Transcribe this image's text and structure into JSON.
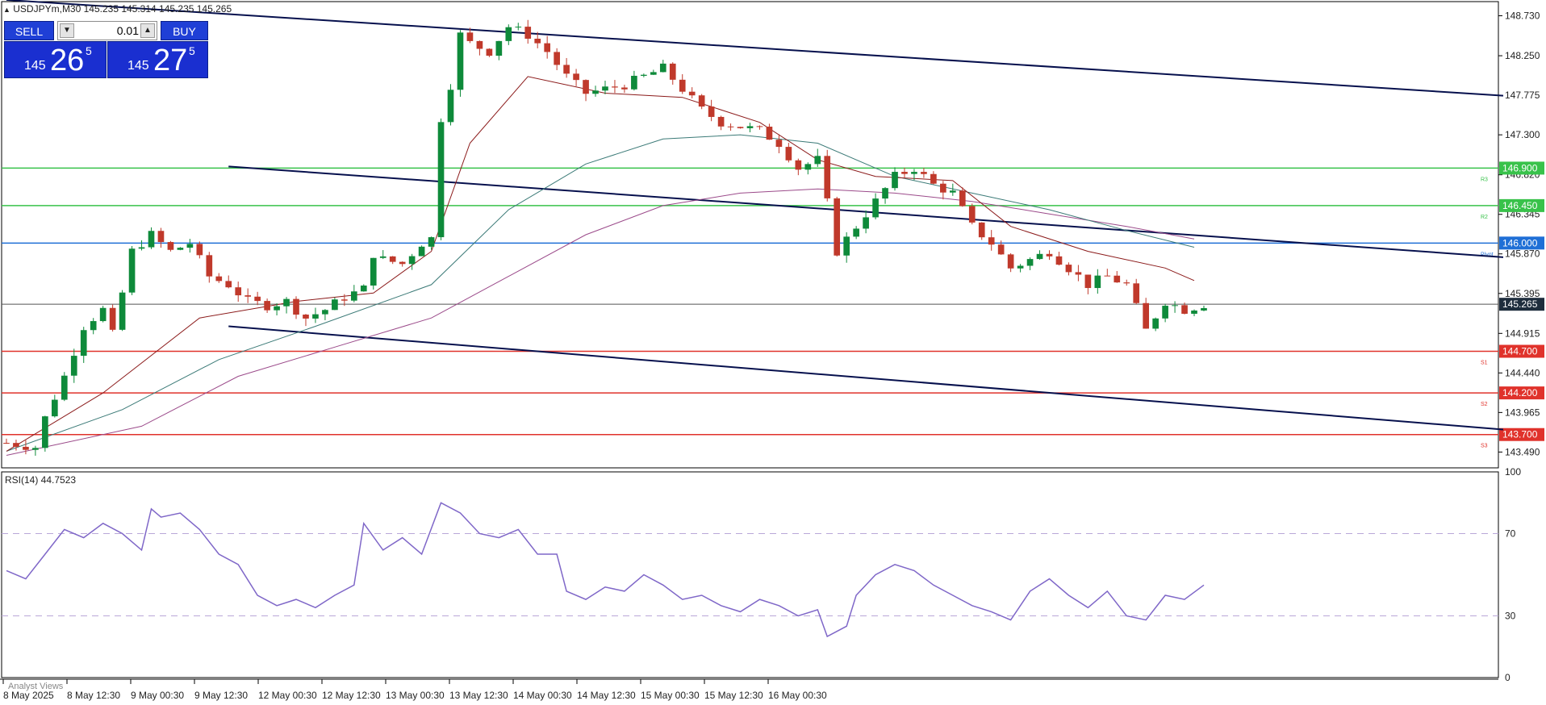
{
  "header": {
    "symbol_text": "USDJPYm,M30  145.235 145.314 145.235 145.265",
    "menu_icon": "triangle-up-icon"
  },
  "trade_panel": {
    "sell_label": "SELL",
    "buy_label": "BUY",
    "lot_value": "0.01",
    "sell_price": {
      "small": "145",
      "big": "26",
      "sup": "5"
    },
    "buy_price": {
      "small": "145",
      "big": "27",
      "sup": "5"
    },
    "colors": {
      "button": "#1f3fd6",
      "price": "#1a2fd0"
    }
  },
  "rsi_title": "RSI(14) 44.7523",
  "bottom_label": "Analyst Views",
  "colors": {
    "bull": "#0e8a3a",
    "bear": "#c0392b",
    "channel": "#06104d",
    "resistance": "#38c24a",
    "pivot": "#1f6fd6",
    "support": "#e0322b",
    "ma_fast": "#8b1a1a",
    "ma_mid": "#3b7a77",
    "ma_slow": "#9b4a8a",
    "rsi": "#7f67c8"
  },
  "chart_data": [
    {
      "type": "candlestick",
      "symbol": "USDJPYm",
      "timeframe": "M30",
      "ohlc_last": {
        "open": 145.235,
        "high": 145.314,
        "low": 145.235,
        "close": 145.265
      },
      "ylim": [
        143.3,
        148.9
      ],
      "y_ticks": [
        148.73,
        148.25,
        147.775,
        147.3,
        146.82,
        146.345,
        145.87,
        145.395,
        144.915,
        144.44,
        143.965,
        143.49
      ],
      "y_tick_labels": [
        "148.730",
        "148.250",
        "147.775",
        "147.300",
        "146.820",
        "146.345",
        "145.870",
        "145.395",
        "144.915",
        "144.440",
        "143.965",
        "143.490"
      ],
      "x_tick_labels": [
        "8 May 2025",
        "8 May 12:30",
        "9 May 00:30",
        "9 May 12:30",
        "12 May 00:30",
        "12 May 12:30",
        "13 May 00:30",
        "13 May 12:30",
        "14 May 00:30",
        "14 May 12:30",
        "15 May 00:30",
        "15 May 12:30",
        "16 May 00:30"
      ],
      "price_path": [
        [
          0,
          143.6
        ],
        [
          3,
          143.55
        ],
        [
          4,
          143.9
        ],
        [
          6,
          144.4
        ],
        [
          8,
          145.0
        ],
        [
          10,
          145.2
        ],
        [
          11,
          144.9
        ],
        [
          13,
          145.9
        ],
        [
          15,
          146.1
        ],
        [
          17,
          145.9
        ],
        [
          19,
          146.0
        ],
        [
          21,
          145.6
        ],
        [
          23,
          145.5
        ],
        [
          25,
          145.3
        ],
        [
          27,
          145.25
        ],
        [
          29,
          145.3
        ],
        [
          31,
          145.1
        ],
        [
          33,
          145.2
        ],
        [
          35,
          145.35
        ],
        [
          37,
          145.45
        ],
        [
          37.6,
          145.9
        ],
        [
          39,
          145.8
        ],
        [
          41,
          145.75
        ],
        [
          43,
          146.0
        ],
        [
          44.8,
          146.1
        ],
        [
          45,
          147.5
        ],
        [
          46,
          147.9
        ],
        [
          47,
          148.5
        ],
        [
          48,
          148.4
        ],
        [
          50,
          148.3
        ],
        [
          52,
          148.6
        ],
        [
          54,
          148.5
        ],
        [
          56,
          148.3
        ],
        [
          58,
          148.0
        ],
        [
          60,
          147.8
        ],
        [
          62,
          147.85
        ],
        [
          64,
          147.9
        ],
        [
          66,
          148.0
        ],
        [
          68,
          148.1
        ],
        [
          70,
          147.85
        ],
        [
          72,
          147.6
        ],
        [
          74,
          147.45
        ],
        [
          76,
          147.4
        ],
        [
          78,
          147.35
        ],
        [
          80,
          147.2
        ],
        [
          82,
          146.9
        ],
        [
          84,
          147.0
        ],
        [
          84.8,
          146.6
        ],
        [
          86,
          145.9
        ],
        [
          88,
          146.2
        ],
        [
          90,
          146.5
        ],
        [
          92,
          146.8
        ],
        [
          94,
          146.9
        ],
        [
          96,
          146.7
        ],
        [
          98,
          146.6
        ],
        [
          100,
          146.2
        ],
        [
          102,
          146.0
        ],
        [
          104,
          145.7
        ],
        [
          106,
          145.8
        ],
        [
          108,
          145.9
        ],
        [
          110,
          145.7
        ],
        [
          112,
          145.5
        ],
        [
          114,
          145.6
        ],
        [
          116,
          145.5
        ],
        [
          118,
          144.95
        ],
        [
          120,
          145.3
        ],
        [
          122,
          145.2
        ],
        [
          124,
          145.265
        ]
      ],
      "indicators": {
        "ma_fast_path": [
          [
            0,
            143.5
          ],
          [
            10,
            144.2
          ],
          [
            20,
            145.1
          ],
          [
            30,
            145.3
          ],
          [
            38,
            145.4
          ],
          [
            44,
            145.9
          ],
          [
            48,
            147.2
          ],
          [
            54,
            148.0
          ],
          [
            62,
            147.8
          ],
          [
            70,
            147.75
          ],
          [
            78,
            147.45
          ],
          [
            84,
            147.0
          ],
          [
            90,
            146.8
          ],
          [
            98,
            146.75
          ],
          [
            104,
            146.2
          ],
          [
            112,
            145.9
          ],
          [
            120,
            145.7
          ],
          [
            123,
            145.55
          ]
        ],
        "ma_mid_path": [
          [
            0,
            143.5
          ],
          [
            12,
            144.0
          ],
          [
            22,
            144.6
          ],
          [
            32,
            145.0
          ],
          [
            44,
            145.5
          ],
          [
            52,
            146.4
          ],
          [
            60,
            146.95
          ],
          [
            68,
            147.25
          ],
          [
            76,
            147.3
          ],
          [
            84,
            147.2
          ],
          [
            92,
            146.8
          ],
          [
            100,
            146.6
          ],
          [
            108,
            146.4
          ],
          [
            116,
            146.15
          ],
          [
            123,
            145.95
          ]
        ],
        "ma_slow_path": [
          [
            0,
            143.45
          ],
          [
            14,
            143.8
          ],
          [
            24,
            144.4
          ],
          [
            34,
            144.75
          ],
          [
            44,
            145.1
          ],
          [
            52,
            145.6
          ],
          [
            60,
            146.1
          ],
          [
            68,
            146.45
          ],
          [
            76,
            146.6
          ],
          [
            84,
            146.65
          ],
          [
            92,
            146.6
          ],
          [
            100,
            146.5
          ],
          [
            108,
            146.35
          ],
          [
            116,
            146.2
          ],
          [
            123,
            146.05
          ]
        ]
      },
      "horizontal_levels": [
        {
          "name": "R3",
          "value": 146.9,
          "label": "146.900",
          "color": "#38c24a"
        },
        {
          "name": "R2",
          "value": 146.45,
          "label": "146.450",
          "color": "#38c24a"
        },
        {
          "name": "Pivot",
          "value": 146.0,
          "label": "146.000",
          "color": "#1f6fd6"
        },
        {
          "name": "S1",
          "value": 144.7,
          "label": "144.700",
          "color": "#e0322b"
        },
        {
          "name": "S2",
          "value": 144.2,
          "label": "144.200",
          "color": "#e0322b"
        },
        {
          "name": "S3",
          "value": 143.7,
          "label": "143.700",
          "color": "#e0322b"
        }
      ],
      "current_price": {
        "value": 145.265,
        "label": "145.265"
      },
      "channel_lines": [
        {
          "from": [
            0,
            148.92
          ],
          "to": [
            155,
            147.77
          ]
        },
        {
          "from": [
            23,
            146.92
          ],
          "to": [
            155,
            145.83
          ]
        },
        {
          "from": [
            23,
            145.0
          ],
          "to": [
            155,
            143.76
          ]
        }
      ]
    },
    {
      "type": "line",
      "title": "RSI(14) 44.7523",
      "ylim": [
        0,
        100
      ],
      "y_ticks": [
        0,
        30,
        70,
        100
      ],
      "levels": [
        30,
        70
      ],
      "values": [
        [
          0,
          52
        ],
        [
          2,
          48
        ],
        [
          4,
          60
        ],
        [
          6,
          72
        ],
        [
          8,
          68
        ],
        [
          10,
          75
        ],
        [
          12,
          70
        ],
        [
          14,
          62
        ],
        [
          15,
          82
        ],
        [
          16,
          78
        ],
        [
          18,
          80
        ],
        [
          20,
          72
        ],
        [
          22,
          60
        ],
        [
          24,
          55
        ],
        [
          26,
          40
        ],
        [
          28,
          35
        ],
        [
          30,
          38
        ],
        [
          32,
          34
        ],
        [
          34,
          40
        ],
        [
          36,
          45
        ],
        [
          37,
          75
        ],
        [
          39,
          62
        ],
        [
          41,
          68
        ],
        [
          43,
          60
        ],
        [
          45,
          85
        ],
        [
          47,
          80
        ],
        [
          49,
          70
        ],
        [
          51,
          68
        ],
        [
          53,
          72
        ],
        [
          55,
          60
        ],
        [
          57,
          60
        ],
        [
          58,
          42
        ],
        [
          60,
          38
        ],
        [
          62,
          44
        ],
        [
          64,
          42
        ],
        [
          66,
          50
        ],
        [
          68,
          45
        ],
        [
          70,
          38
        ],
        [
          72,
          40
        ],
        [
          74,
          35
        ],
        [
          76,
          32
        ],
        [
          78,
          38
        ],
        [
          80,
          35
        ],
        [
          82,
          30
        ],
        [
          84,
          33
        ],
        [
          85,
          20
        ],
        [
          87,
          25
        ],
        [
          88,
          40
        ],
        [
          90,
          50
        ],
        [
          92,
          55
        ],
        [
          94,
          52
        ],
        [
          96,
          45
        ],
        [
          98,
          40
        ],
        [
          100,
          35
        ],
        [
          102,
          32
        ],
        [
          104,
          28
        ],
        [
          106,
          42
        ],
        [
          108,
          48
        ],
        [
          110,
          40
        ],
        [
          112,
          34
        ],
        [
          114,
          42
        ],
        [
          116,
          30
        ],
        [
          118,
          28
        ],
        [
          120,
          40
        ],
        [
          122,
          38
        ],
        [
          124,
          45
        ]
      ]
    }
  ]
}
